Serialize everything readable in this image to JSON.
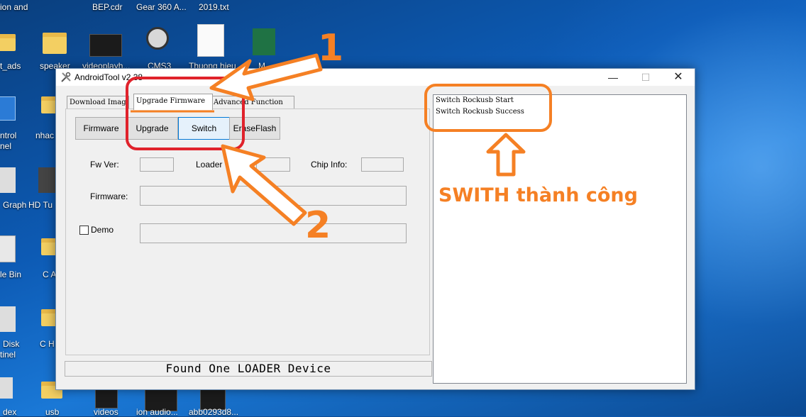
{
  "desktop": {
    "icons": [
      {
        "label": "ion and"
      },
      {
        "label": "BEP.cdr"
      },
      {
        "label": "Gear 360 A..."
      },
      {
        "label": "2019.txt"
      },
      {
        "label": "t_ads"
      },
      {
        "label": "speaker"
      },
      {
        "label": "videoplayh..."
      },
      {
        "label": "CMS3"
      },
      {
        "label": "Thuong hieu"
      },
      {
        "label": "M"
      },
      {
        "label": "ntrol"
      },
      {
        "label": "nel"
      },
      {
        "label": "nhac"
      },
      {
        "label": "Graph"
      },
      {
        "label": "HD Tu"
      },
      {
        "label": "le Bin"
      },
      {
        "label": "C A"
      },
      {
        "label": "Disk"
      },
      {
        "label": "tinel"
      },
      {
        "label": "C H"
      },
      {
        "label": "dex"
      },
      {
        "label": "usb"
      },
      {
        "label": "videos"
      },
      {
        "label": "ion audio..."
      },
      {
        "label": "abb0293d8..."
      }
    ]
  },
  "window": {
    "title": "AndroidTool v2.38",
    "controls": {
      "minimize": "—",
      "maximize": "☐",
      "close": "✕"
    }
  },
  "tabs": [
    {
      "label": "Download Image"
    },
    {
      "label": "Upgrade Firmware"
    },
    {
      "label": "Advanced Function"
    }
  ],
  "buttons": {
    "firmware": "Firmware",
    "upgrade": "Upgrade",
    "switch": "Switch",
    "erase_flash": "EraseFlash"
  },
  "fields": {
    "fw_ver_label": "Fw Ver:",
    "loader_ver_label": "Loader Ver:",
    "chip_info_label": "Chip Info:",
    "firmware_label": "Firmware:",
    "demo_label": "Demo"
  },
  "status": "Found One LOADER Device",
  "log": [
    "Switch Rockusb Start",
    "Switch Rockusb Success"
  ],
  "annotations": {
    "callout_text": "SWITH thành công",
    "step1": "1",
    "step2": "2",
    "color": "#f58024",
    "highlight_red": "#e0222b"
  }
}
